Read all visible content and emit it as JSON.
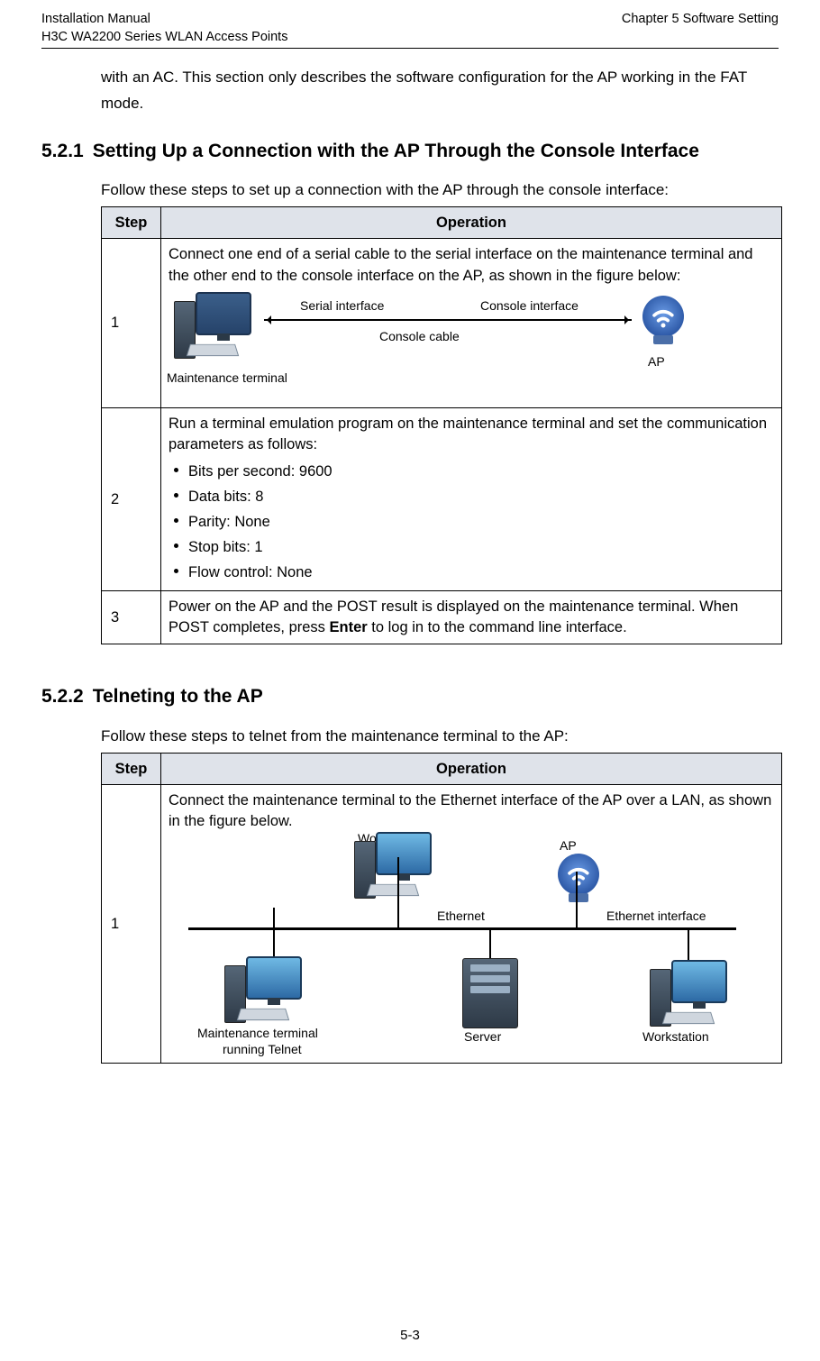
{
  "header": {
    "left1": "Installation Manual",
    "left2": "H3C WA2200 Series WLAN Access Points",
    "right1": "",
    "right2": "Chapter 5  Software Setting"
  },
  "intro_para": "with an AC. This section only describes the software configuration for the AP working in the FAT mode.",
  "section_521": {
    "num": "5.2.1",
    "title": "Setting Up a Connection with the AP Through the Console Interface",
    "lead": "Follow these steps to set up a connection with the AP through the console interface:",
    "table": {
      "step_hdr": "Step",
      "op_hdr": "Operation",
      "rows": [
        {
          "step": "1",
          "op_text": "Connect one end of a serial cable to the serial interface on the maintenance terminal and the other end to the console interface on the AP, as shown in the figure below:",
          "diagram": {
            "serial_interface": "Serial interface",
            "console_interface": "Console interface",
            "console_cable": "Console cable",
            "maintenance_terminal": "Maintenance terminal",
            "ap": "AP"
          }
        },
        {
          "step": "2",
          "op_text": "Run a terminal emulation program on the maintenance terminal and set the communication parameters as follows:",
          "params": [
            "Bits per second: 9600",
            "Data bits: 8",
            "Parity: None",
            "Stop bits: 1",
            "Flow control: None"
          ]
        },
        {
          "step": "3",
          "op_text_pre": "Power on the AP and the POST result is displayed on the maintenance terminal. When POST completes, press ",
          "op_text_bold": "Enter",
          "op_text_post": " to log in to the command line interface."
        }
      ]
    }
  },
  "section_522": {
    "num": "5.2.2",
    "title": "Telneting to the AP",
    "lead": "Follow these steps to telnet from the maintenance terminal to the AP:",
    "table": {
      "step_hdr": "Step",
      "op_hdr": "Operation",
      "rows": [
        {
          "step": "1",
          "op_text": "Connect the maintenance terminal to the Ethernet interface of the AP over a LAN, as shown in the figure below.",
          "diagram": {
            "workstation": "Workstation",
            "ap": "AP",
            "ethernet": "Ethernet",
            "ethernet_interface": "Ethernet interface",
            "maintenance_terminal_l1": "Maintenance terminal",
            "maintenance_terminal_l2": "running Telnet",
            "server": "Server",
            "workstation_bottom": "Workstation"
          }
        }
      ]
    }
  },
  "footer": "5-3"
}
